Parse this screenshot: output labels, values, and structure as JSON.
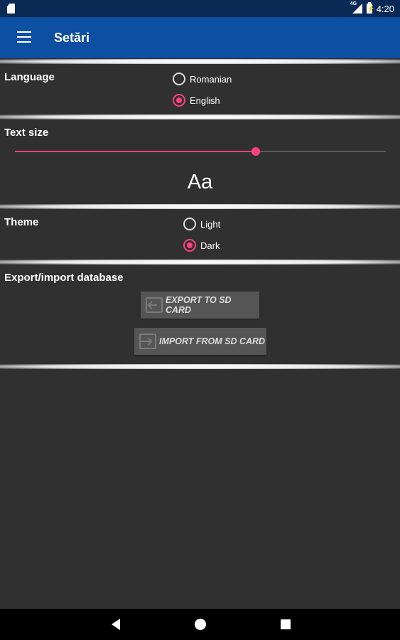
{
  "status_bar": {
    "time": "4:20",
    "network": "4G"
  },
  "app_bar": {
    "title": "Setări",
    "menu_icon": "menu-icon"
  },
  "language": {
    "label": "Language",
    "options": [
      "Romanian",
      "English"
    ],
    "selected": "English"
  },
  "text_size": {
    "label": "Text size",
    "level": 0.65,
    "sample": "Aa"
  },
  "theme": {
    "label": "Theme",
    "options": [
      "Light",
      "Dark"
    ],
    "selected": "Dark"
  },
  "database": {
    "label": "Export/import database",
    "export_label": "EXPORT TO SD CARD",
    "import_label": "IMPORT FROM SD CARD"
  },
  "colors": {
    "app_bar": "#0d4fa0",
    "status_bar": "#0a2a55",
    "background": "#303030",
    "accent": "#ff4081",
    "button": "#555555"
  },
  "nav_bar": {
    "icons": [
      "back-icon",
      "home-icon",
      "recents-icon"
    ]
  }
}
